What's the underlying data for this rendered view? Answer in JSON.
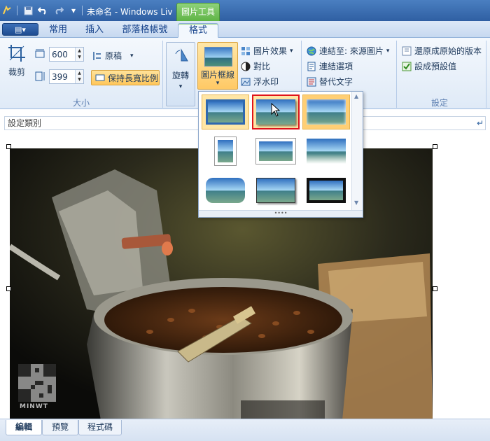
{
  "window": {
    "title": "未命名 - Windows Liv",
    "context_tab_group": "圖片工具"
  },
  "app_menu": {
    "label": "▤▾"
  },
  "tabs": [
    {
      "label": "常用",
      "active": false
    },
    {
      "label": "插入",
      "active": false
    },
    {
      "label": "部落格帳號",
      "active": false
    },
    {
      "label": "格式",
      "active": true
    }
  ],
  "ribbon": {
    "size_group": {
      "label": "大小",
      "crop_label": "裁剪",
      "width_value": "600",
      "height_value": "399",
      "original_label": "原稿",
      "aspect_ratio_label": "保持長寬比例"
    },
    "rotate_label": "旋轉",
    "frame_label": "圖片框線",
    "effects_label": "圖片效果",
    "contrast_label": "對比",
    "watermark_label": "浮水印",
    "link_to_label": "連結至: 來源圖片",
    "link_options_label": "連結選項",
    "alt_text_label": "替代文字",
    "settings_group": {
      "label": "設定",
      "restore_label": "還原成原始的版本",
      "set_default_label": "設成預設值"
    }
  },
  "gallery": {
    "grip_label": "••••",
    "selected_index": 1
  },
  "category_bar": {
    "label": "設定類別"
  },
  "photo": {
    "watermark_text": "MINWT"
  },
  "bottom_tabs": [
    {
      "label": "編輯",
      "active": true
    },
    {
      "label": "預覽",
      "active": false
    },
    {
      "label": "程式碼",
      "active": false
    }
  ],
  "colors": {
    "accent": "#4a7fc1",
    "highlight": "#ffc965",
    "selection_border": "#e0141a",
    "context_green": "#5fb446"
  }
}
